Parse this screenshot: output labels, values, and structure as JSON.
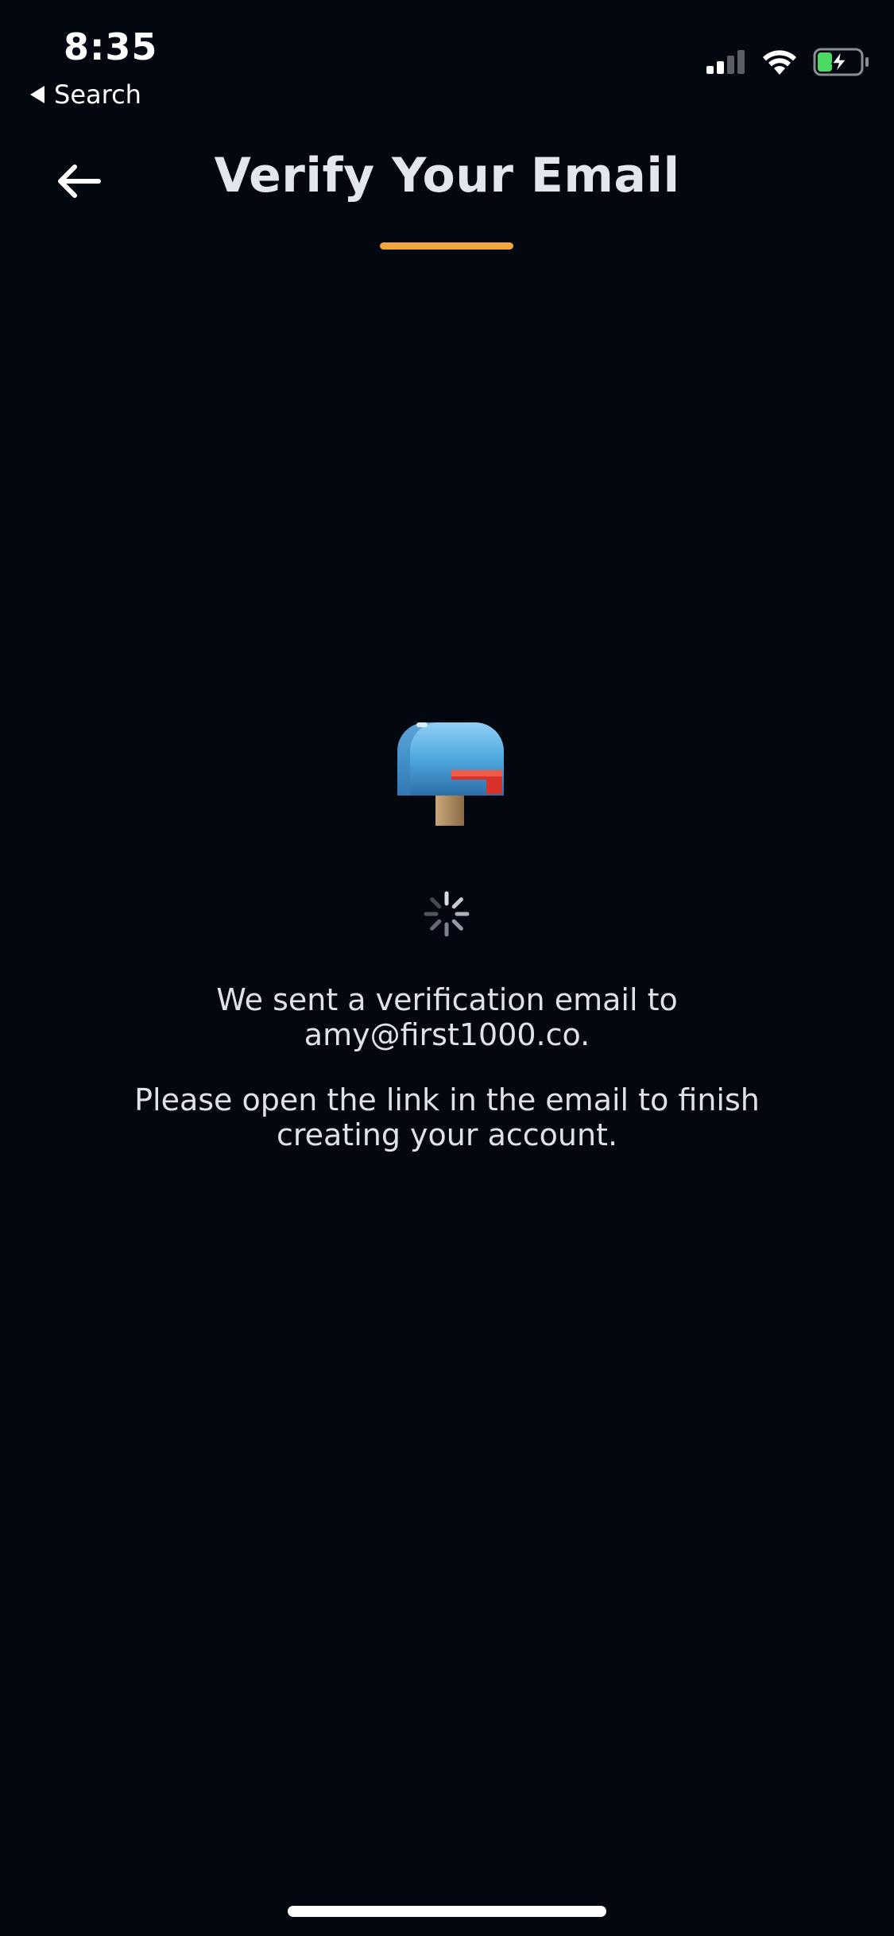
{
  "status_bar": {
    "time": "8:35",
    "back_label": "Search",
    "battery_color": "#4cd964"
  },
  "header": {
    "title": "Verify Your Email",
    "accent_color": "#f2a53a",
    "back_icon": "arrow-left-icon"
  },
  "content": {
    "illustration_icon": "mailbox-icon",
    "loading_icon": "spinner-icon",
    "message_line1": "We sent a verification email to",
    "message_email": "amy@first1000.co.",
    "instruction_line1": "Please open the link in the email to finish",
    "instruction_line2": "creating your account."
  }
}
